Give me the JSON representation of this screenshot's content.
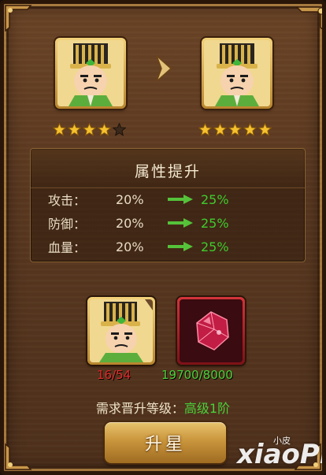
{
  "hero": {
    "current_stars": 4,
    "next_stars": 5,
    "max_stars": 5
  },
  "attributes": {
    "title": "属性提升",
    "rows": [
      {
        "label": "攻击：",
        "old": "20%",
        "new": "25%"
      },
      {
        "label": "防御：",
        "old": "20%",
        "new": "25%"
      },
      {
        "label": "血量：",
        "old": "20%",
        "new": "25%"
      }
    ]
  },
  "materials": {
    "shard_count": "16/54",
    "crystal_count": "19700/8000"
  },
  "requirement": {
    "label": "需求晋升等级：",
    "value": "高级1阶"
  },
  "actions": {
    "upgrade_label": "升星"
  },
  "watermark": {
    "text": "xiaoPi",
    "small": "小皮"
  },
  "colors": {
    "increase_green": "#3fcb2e",
    "shard_red": "#e02a2a",
    "frame_gold": "#f3d27a",
    "frame_red": "#d4343a"
  }
}
